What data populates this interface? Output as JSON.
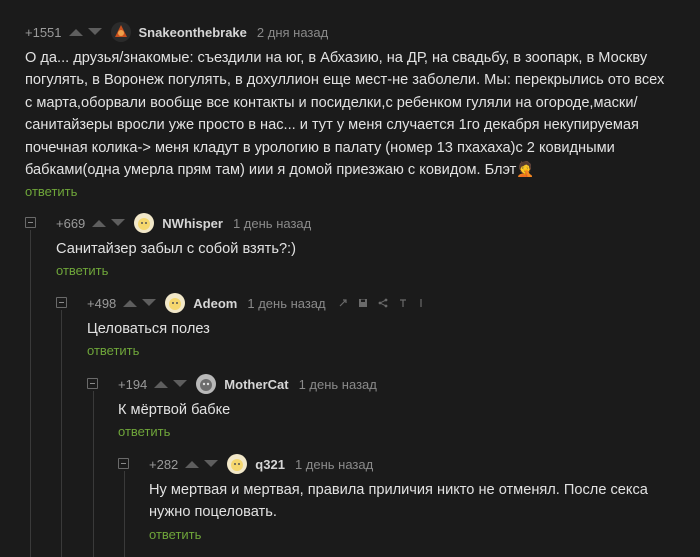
{
  "comments": [
    {
      "rating": "+1551",
      "username": "Snakeonthebrake",
      "time": "2 дня назад",
      "text": "О да... друзья/знакомые: съездили на юг, в Абхазию, на ДР, на свадьбу, в зоопарк, в Москву погулять, в Воронеж погулять, в дохуллион еще мест-не заболели. Мы: перекрылись ото всех с марта,оборвали вообще все контакты и посиделки,с ребенком гуляли на огороде,маски/санитайзеры вросли уже просто в нас... и тут у меня случается 1го декабря некупируемая почечная колика-> меня кладут в урологию в палату (номер 13 пхахаха)с 2 ковидными бабками(одна умерла прям там) иии я домой приезжаю с ковидом. Блэт🤦",
      "reply": "ответить"
    },
    {
      "rating": "+669",
      "username": "NWhisper",
      "time": "1 день назад",
      "text": "Санитайзер забыл с собой взять?:)",
      "reply": "ответить"
    },
    {
      "rating": "+498",
      "username": "Adeom",
      "time": "1 день назад",
      "text": "Целоваться полез",
      "reply": "ответить"
    },
    {
      "rating": "+194",
      "username": "MotherCat",
      "time": "1 день назад",
      "text": "К мёртвой бабке",
      "reply": "ответить"
    },
    {
      "rating": "+282",
      "username": "q321",
      "time": "1 день назад",
      "text": "Ну мертвая и мертвая, правила приличия никто не отменял. После секса нужно поцеловать.",
      "reply": "ответить"
    }
  ],
  "icons": {
    "upvote": "arrow-up-icon",
    "downvote": "arrow-down-icon",
    "collapse": "minus-square-icon",
    "link": "link-icon",
    "save": "save-icon",
    "share": "share-icon",
    "more": "more-icon"
  },
  "colors": {
    "background": "#1b1b1b",
    "reply_link": "#6fa63a",
    "text": "#e2e2e2",
    "muted": "#8a8a8a"
  }
}
